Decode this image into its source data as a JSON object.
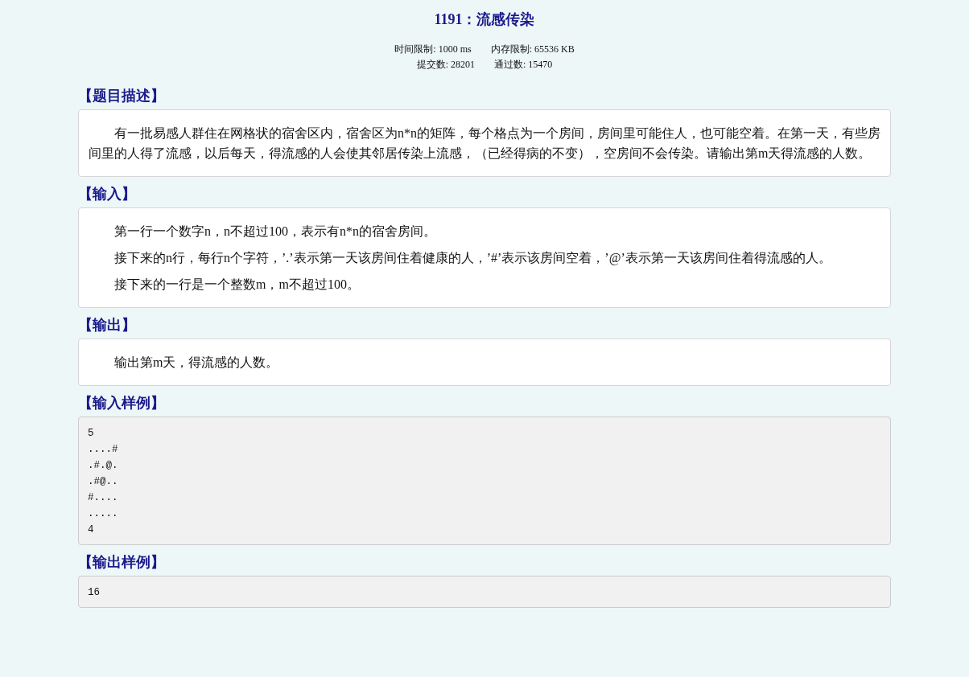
{
  "title": "1191：流感传染",
  "stats": [
    {
      "label": "时间限制:",
      "value": "1000 ms"
    },
    {
      "label": "内存限制:",
      "value": "65536 KB"
    },
    {
      "label": "提交数:",
      "value": "28201"
    },
    {
      "label": "通过数:",
      "value": "15470"
    }
  ],
  "sections": [
    {
      "heading": "【题目描述】",
      "kind": "text",
      "paragraphs": [
        "有一批易感人群住在网格状的宿舍区内，宿舍区为n*n的矩阵，每个格点为一个房间，房间里可能住人，也可能空着。在第一天，有些房间里的人得了流感，以后每天，得流感的人会使其邻居传染上流感，（已经得病的不变），空房间不会传染。请输出第m天得流感的人数。"
      ]
    },
    {
      "heading": "【输入】",
      "kind": "text",
      "paragraphs": [
        "第一行一个数字n，n不超过100，表示有n*n的宿舍房间。",
        "接下来的n行，每行n个字符，’.’表示第一天该房间住着健康的人，’#’表示该房间空着，’@’表示第一天该房间住着得流感的人。",
        "接下来的一行是一个整数m，m不超过100。"
      ]
    },
    {
      "heading": "【输出】",
      "kind": "text",
      "paragraphs": [
        "输出第m天，得流感的人数。"
      ]
    },
    {
      "heading": "【输入样例】",
      "kind": "code",
      "lines": [
        "5",
        "....#",
        ".#.@.",
        ".#@..",
        "#....",
        ".....",
        "4"
      ]
    },
    {
      "heading": "【输出样例】",
      "kind": "code",
      "lines": [
        "16"
      ]
    }
  ]
}
